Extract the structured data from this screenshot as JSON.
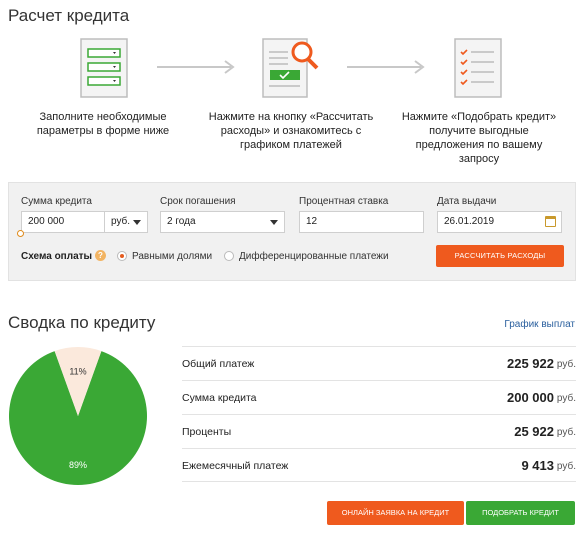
{
  "page": {
    "title": "Расчет кредита"
  },
  "steps": [
    {
      "text": "Заполните необходимые параметры в форме ниже"
    },
    {
      "text": "Нажмите на кнопку «Рассчитать расходы» и ознакомитесь с графиком платежей"
    },
    {
      "text": "Нажмите «Подобрать кредит» получите выгодные предложения по вашему запросу"
    }
  ],
  "form": {
    "amount_label": "Сумма кредита",
    "amount_value": "200 000",
    "currency": "руб.",
    "term_label": "Срок погашения",
    "term_value": "2 года",
    "rate_label": "Процентная ставка",
    "rate_value": "12",
    "date_label": "Дата выдачи",
    "date_value": "26.01.2019",
    "scheme_label": "Схема оплаты",
    "help_glyph": "?",
    "option_equal": "Равными долями",
    "option_diff": "Дифференцированные платежи",
    "selected_option": "equal",
    "calc_button": "РАССЧИТАТЬ РАСХОДЫ"
  },
  "summary": {
    "title": "Сводка по кредиту",
    "schedule_link": "График выплат",
    "rows": [
      {
        "label": "Общий платеж",
        "value": "225 922",
        "unit": "руб."
      },
      {
        "label": "Сумма кредита",
        "value": "200 000",
        "unit": "руб."
      },
      {
        "label": "Проценты",
        "value": "25 922",
        "unit": "руб."
      },
      {
        "label": "Ежемесячный платеж",
        "value": "9 413",
        "unit": "руб."
      }
    ],
    "pie": {
      "slices": [
        {
          "label": "89%",
          "value": 89,
          "color": "#3aa835"
        },
        {
          "label": "11%",
          "value": 11,
          "color": "#fbe9dc"
        }
      ]
    }
  },
  "buttons": {
    "online": "ОНЛАЙН ЗАЯВКА НА КРЕДИТ",
    "pick": "ПОДОБРАТЬ КРЕДИТ"
  },
  "colors": {
    "accent_orange": "#ef5a1e",
    "accent_green": "#3aa835",
    "link_blue": "#2a5f9e"
  }
}
